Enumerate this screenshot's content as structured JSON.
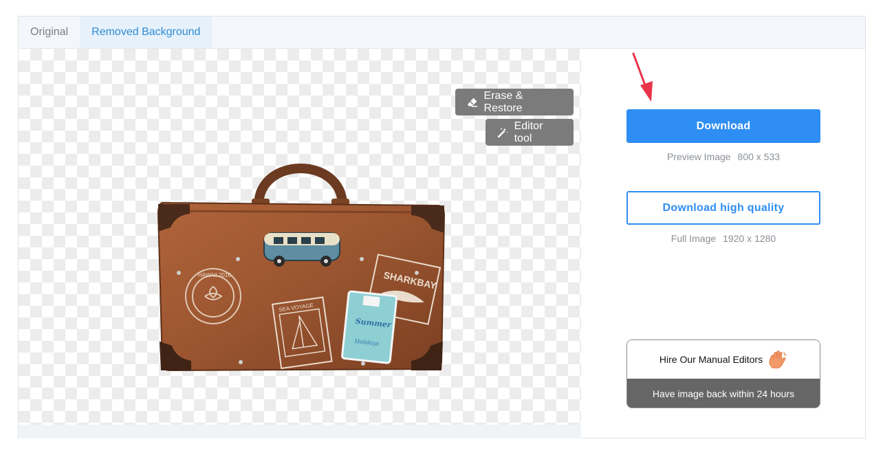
{
  "tabs": [
    {
      "label": "Original",
      "active": false
    },
    {
      "label": "Removed Background",
      "active": true
    }
  ],
  "canvas": {
    "erase_restore_label": "Erase & Restore",
    "editor_tool_label": "Editor tool",
    "image_subject": "suitcase-with-travel-stickers",
    "sticker_text": {
      "hawaii_stamp": "HAWAII 2016",
      "sharkbay_stamp": "SHARKBAY",
      "sea_voyage": "SEA VOYAGE",
      "summer_tag_1": "Summer",
      "summer_tag_2": "Holidays"
    }
  },
  "sidebar": {
    "download_label": "Download",
    "preview_label": "Preview Image",
    "preview_size": "800 x 533",
    "download_hq_label": "Download high quality",
    "full_label": "Full Image",
    "full_size": "1920 x 1280",
    "hire_title": "Hire Our Manual Editors",
    "hire_subtitle": "Have image back within 24 hours"
  },
  "colors": {
    "accent": "#2e8ef3",
    "active_tab_text": "#2f8bd3",
    "arrow": "#e8334a",
    "tool_button": "#7b7b7b",
    "hire_banner": "#666666"
  },
  "icons": [
    "eraser-icon",
    "magic-wand-icon",
    "red-arrow-icon",
    "waving-hand-icon"
  ]
}
